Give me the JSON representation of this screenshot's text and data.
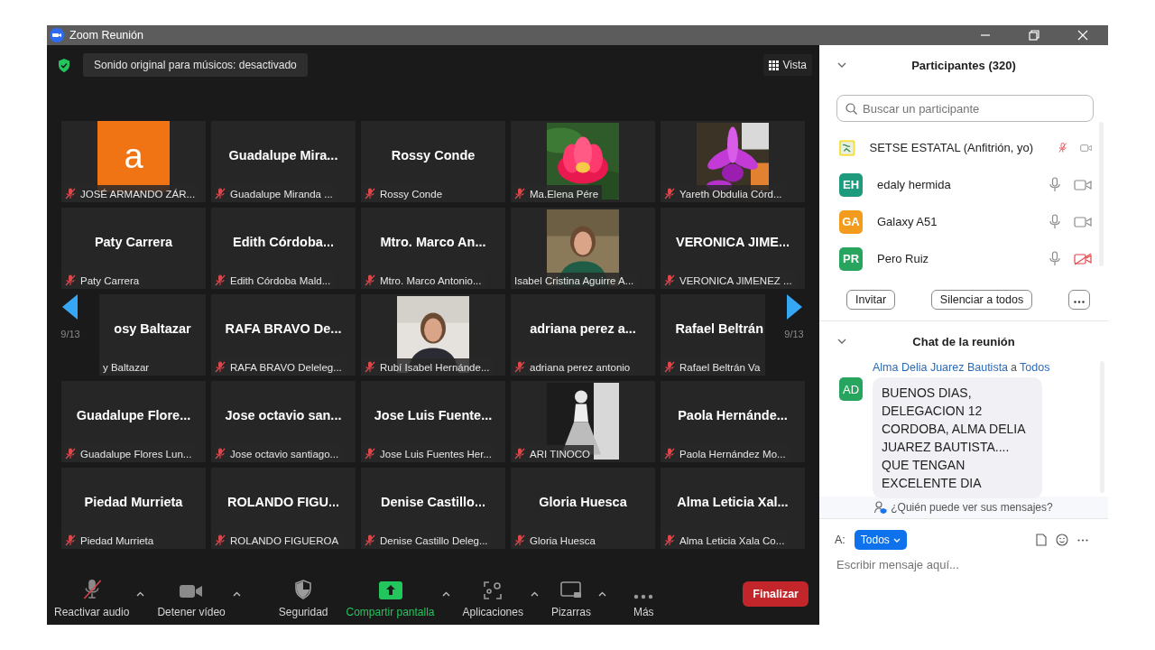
{
  "window": {
    "title": "Zoom Reunión"
  },
  "top_bar": {
    "audio_notice": "Sonido original para músicos: desactivado",
    "view_button": "Vista"
  },
  "pager": {
    "left_count": "9/13",
    "right_count": "9/13"
  },
  "tiles": [
    {
      "kind": "letter",
      "letter": "a",
      "label": "JOSÉ ARMANDO ZÁR...",
      "muted": true
    },
    {
      "kind": "name",
      "title": "Guadalupe Mira...",
      "label": "Guadalupe Miranda ...",
      "muted": true
    },
    {
      "kind": "name",
      "title": "Rossy Conde",
      "label": "Rossy Conde",
      "muted": true
    },
    {
      "kind": "picture",
      "label": "Ma.Elena Pére",
      "muted": true
    },
    {
      "kind": "picture",
      "label": "Yareth Obdulia Córd...",
      "muted": true
    },
    {
      "kind": "name",
      "title": "Paty Carrera",
      "label": "Paty Carrera",
      "muted": true
    },
    {
      "kind": "name",
      "title": "Edith Córdoba...",
      "label": "Edith Córdoba Mald...",
      "muted": true
    },
    {
      "kind": "name",
      "title": "Mtro. Marco An...",
      "label": "Mtro. Marco Antonio...",
      "muted": true
    },
    {
      "kind": "picture",
      "label": "Isabel Cristina Aguirre A...",
      "muted": false
    },
    {
      "kind": "name",
      "title": "VERONICA JIME...",
      "label": "VERONICA JIMENEZ ...",
      "muted": true
    },
    {
      "kind": "name",
      "title": "osy Baltazar",
      "label": "y Baltazar",
      "muted": false,
      "clipped": true
    },
    {
      "kind": "name",
      "title": "RAFA BRAVO De...",
      "label": "RAFA BRAVO Deleleg...",
      "muted": true
    },
    {
      "kind": "picture",
      "label": "Rubí Isabel Hernánde...",
      "muted": true
    },
    {
      "kind": "name",
      "title": "adriana perez a...",
      "label": "adriana perez antonio",
      "muted": true
    },
    {
      "kind": "name",
      "title": "Rafael Beltrán",
      "label": "Rafael Beltrán Va",
      "muted": true,
      "clipped": true
    },
    {
      "kind": "name",
      "title": "Guadalupe Flore...",
      "label": "Guadalupe Flores Lun...",
      "muted": true
    },
    {
      "kind": "name",
      "title": "Jose octavio san...",
      "label": "Jose octavio santiago...",
      "muted": true
    },
    {
      "kind": "name",
      "title": "Jose Luis Fuente...",
      "label": "Jose Luis Fuentes Her...",
      "muted": true
    },
    {
      "kind": "picture",
      "label": "ARI TINOCO",
      "muted": true
    },
    {
      "kind": "name",
      "title": "Paola Hernánde...",
      "label": "Paola Hernández Mo...",
      "muted": true
    },
    {
      "kind": "name",
      "title": "Piedad Murrieta",
      "label": "Piedad Murrieta",
      "muted": true
    },
    {
      "kind": "name",
      "title": "ROLANDO FIGU...",
      "label": "ROLANDO FIGUEROA",
      "muted": true
    },
    {
      "kind": "name",
      "title": "Denise Castillo...",
      "label": "Denise Castillo Deleg...",
      "muted": true
    },
    {
      "kind": "name",
      "title": "Gloria Huesca",
      "label": "Gloria Huesca",
      "muted": true
    },
    {
      "kind": "name",
      "title": "Alma Leticia Xal...",
      "label": "Alma Leticia Xala  Co...",
      "muted": true
    }
  ],
  "toolbar": [
    {
      "kind": "audio",
      "label": "Reactivar audio",
      "muted": true,
      "caret": true
    },
    {
      "kind": "video",
      "label": "Detener vídeo",
      "caret": true
    },
    {
      "kind": "security",
      "label": "Seguridad",
      "caret": false
    },
    {
      "kind": "share",
      "label": "Compartir pantalla",
      "caret": true
    },
    {
      "kind": "apps",
      "label": "Aplicaciones",
      "caret": true
    },
    {
      "kind": "whiteboard",
      "label": "Pizarras",
      "caret": true
    },
    {
      "kind": "more",
      "label": "Más",
      "caret": false
    }
  ],
  "end_button": "Finalizar",
  "participants": {
    "title": "Participantes (320)",
    "search": {
      "placeholder": "Buscar un participante"
    },
    "items": [
      {
        "kind": "logo",
        "name": "SETSE ESTATAL (Anfitrión, yo)",
        "mic_muted": true,
        "video_off": false
      },
      {
        "kind": "initials",
        "initials": "EH",
        "color": "#1e9a7c",
        "name": "edaly hermida",
        "mic_muted": false,
        "video_off": false
      },
      {
        "kind": "initials",
        "initials": "GA",
        "color": "#f29b1d",
        "name": "Galaxy A51",
        "mic_muted": false,
        "video_off": false
      },
      {
        "kind": "initials",
        "initials": "PR",
        "color": "#27a55e",
        "name": "Pero Ruiz",
        "mic_muted": false,
        "video_off": true
      }
    ],
    "buttons": [
      "Invitar",
      "Silenciar a todos"
    ]
  },
  "chat": {
    "title": "Chat de la reunión",
    "messages": [
      {
        "sender": "Alma Delia Juarez Bautista",
        "to_word": "a",
        "recipient": "Todos",
        "initials": "AD",
        "color": "#27a55e",
        "text": "BUENOS DIAS, DELEGACION 12 CORDOBA, ALMA DELIA JUAREZ BAUTISTA.... QUE TENGAN EXCELENTE DIA"
      }
    ],
    "privacy_note": "¿Quién puede ver sus mensajes?",
    "to_label": "A:",
    "to_value": "Todos",
    "input": {
      "placeholder": "Escribir mensaje aquí..."
    }
  }
}
